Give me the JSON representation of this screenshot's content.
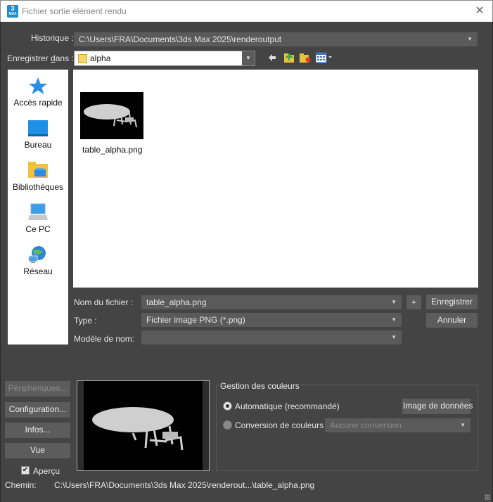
{
  "window": {
    "title": "Fichier sortie élément rendu",
    "app_icon_text": "3",
    "app_icon_subtext": "MAX"
  },
  "history": {
    "label": "Historique :",
    "value": "C:\\Users\\FRA\\Documents\\3ds Max 2025\\renderoutput"
  },
  "save_in": {
    "label_prefix": "Enregistrer ",
    "label_underlined": "d",
    "label_suffix": "ans :",
    "folder": "alpha"
  },
  "toolbar": {
    "icons": [
      "back-arrow-icon",
      "up-folder-icon",
      "new-folder-icon",
      "view-menu-icon"
    ]
  },
  "places": [
    {
      "label": "Accès rapide",
      "icon": "quick-access-star-icon"
    },
    {
      "label": "Bureau",
      "icon": "desktop-icon"
    },
    {
      "label": "Bibliothèques",
      "icon": "libraries-icon"
    },
    {
      "label": "Ce PC",
      "icon": "this-pc-icon"
    },
    {
      "label": "Réseau",
      "icon": "network-icon"
    }
  ],
  "files": [
    {
      "name": "table_alpha.png"
    }
  ],
  "form": {
    "filename_label": "Nom du fichier :",
    "filename_value": "table_alpha.png",
    "type_label": "Type :",
    "type_value": "Fichier image PNG (*.png)",
    "template_label": "Modèle de nom:",
    "template_value": "",
    "plus_label": "+",
    "save_button": "Enregistrer",
    "cancel_button": "Annuler"
  },
  "side_buttons": {
    "devices": "Périphériques...",
    "setup": "Configuration...",
    "info": "Infos...",
    "view": "Vue"
  },
  "preview": {
    "checkbox_label": "Aperçu",
    "checked": true
  },
  "color_management": {
    "title": "Gestion des couleurs",
    "auto_label": "Automatique (recommandé)",
    "auto_selected": true,
    "data_image_button": "Image de données",
    "convert_label": "Conversion de couleurs :",
    "convert_value": "Aucune conversion"
  },
  "path": {
    "label": "Chemin:",
    "value": "C:\\Users\\FRA\\Documents\\3ds Max 2025\\renderout...\\table_alpha.png"
  },
  "colors": {
    "background": "#444444",
    "field": "#5a5a5a",
    "accent_blue": "#1d8fd0"
  }
}
